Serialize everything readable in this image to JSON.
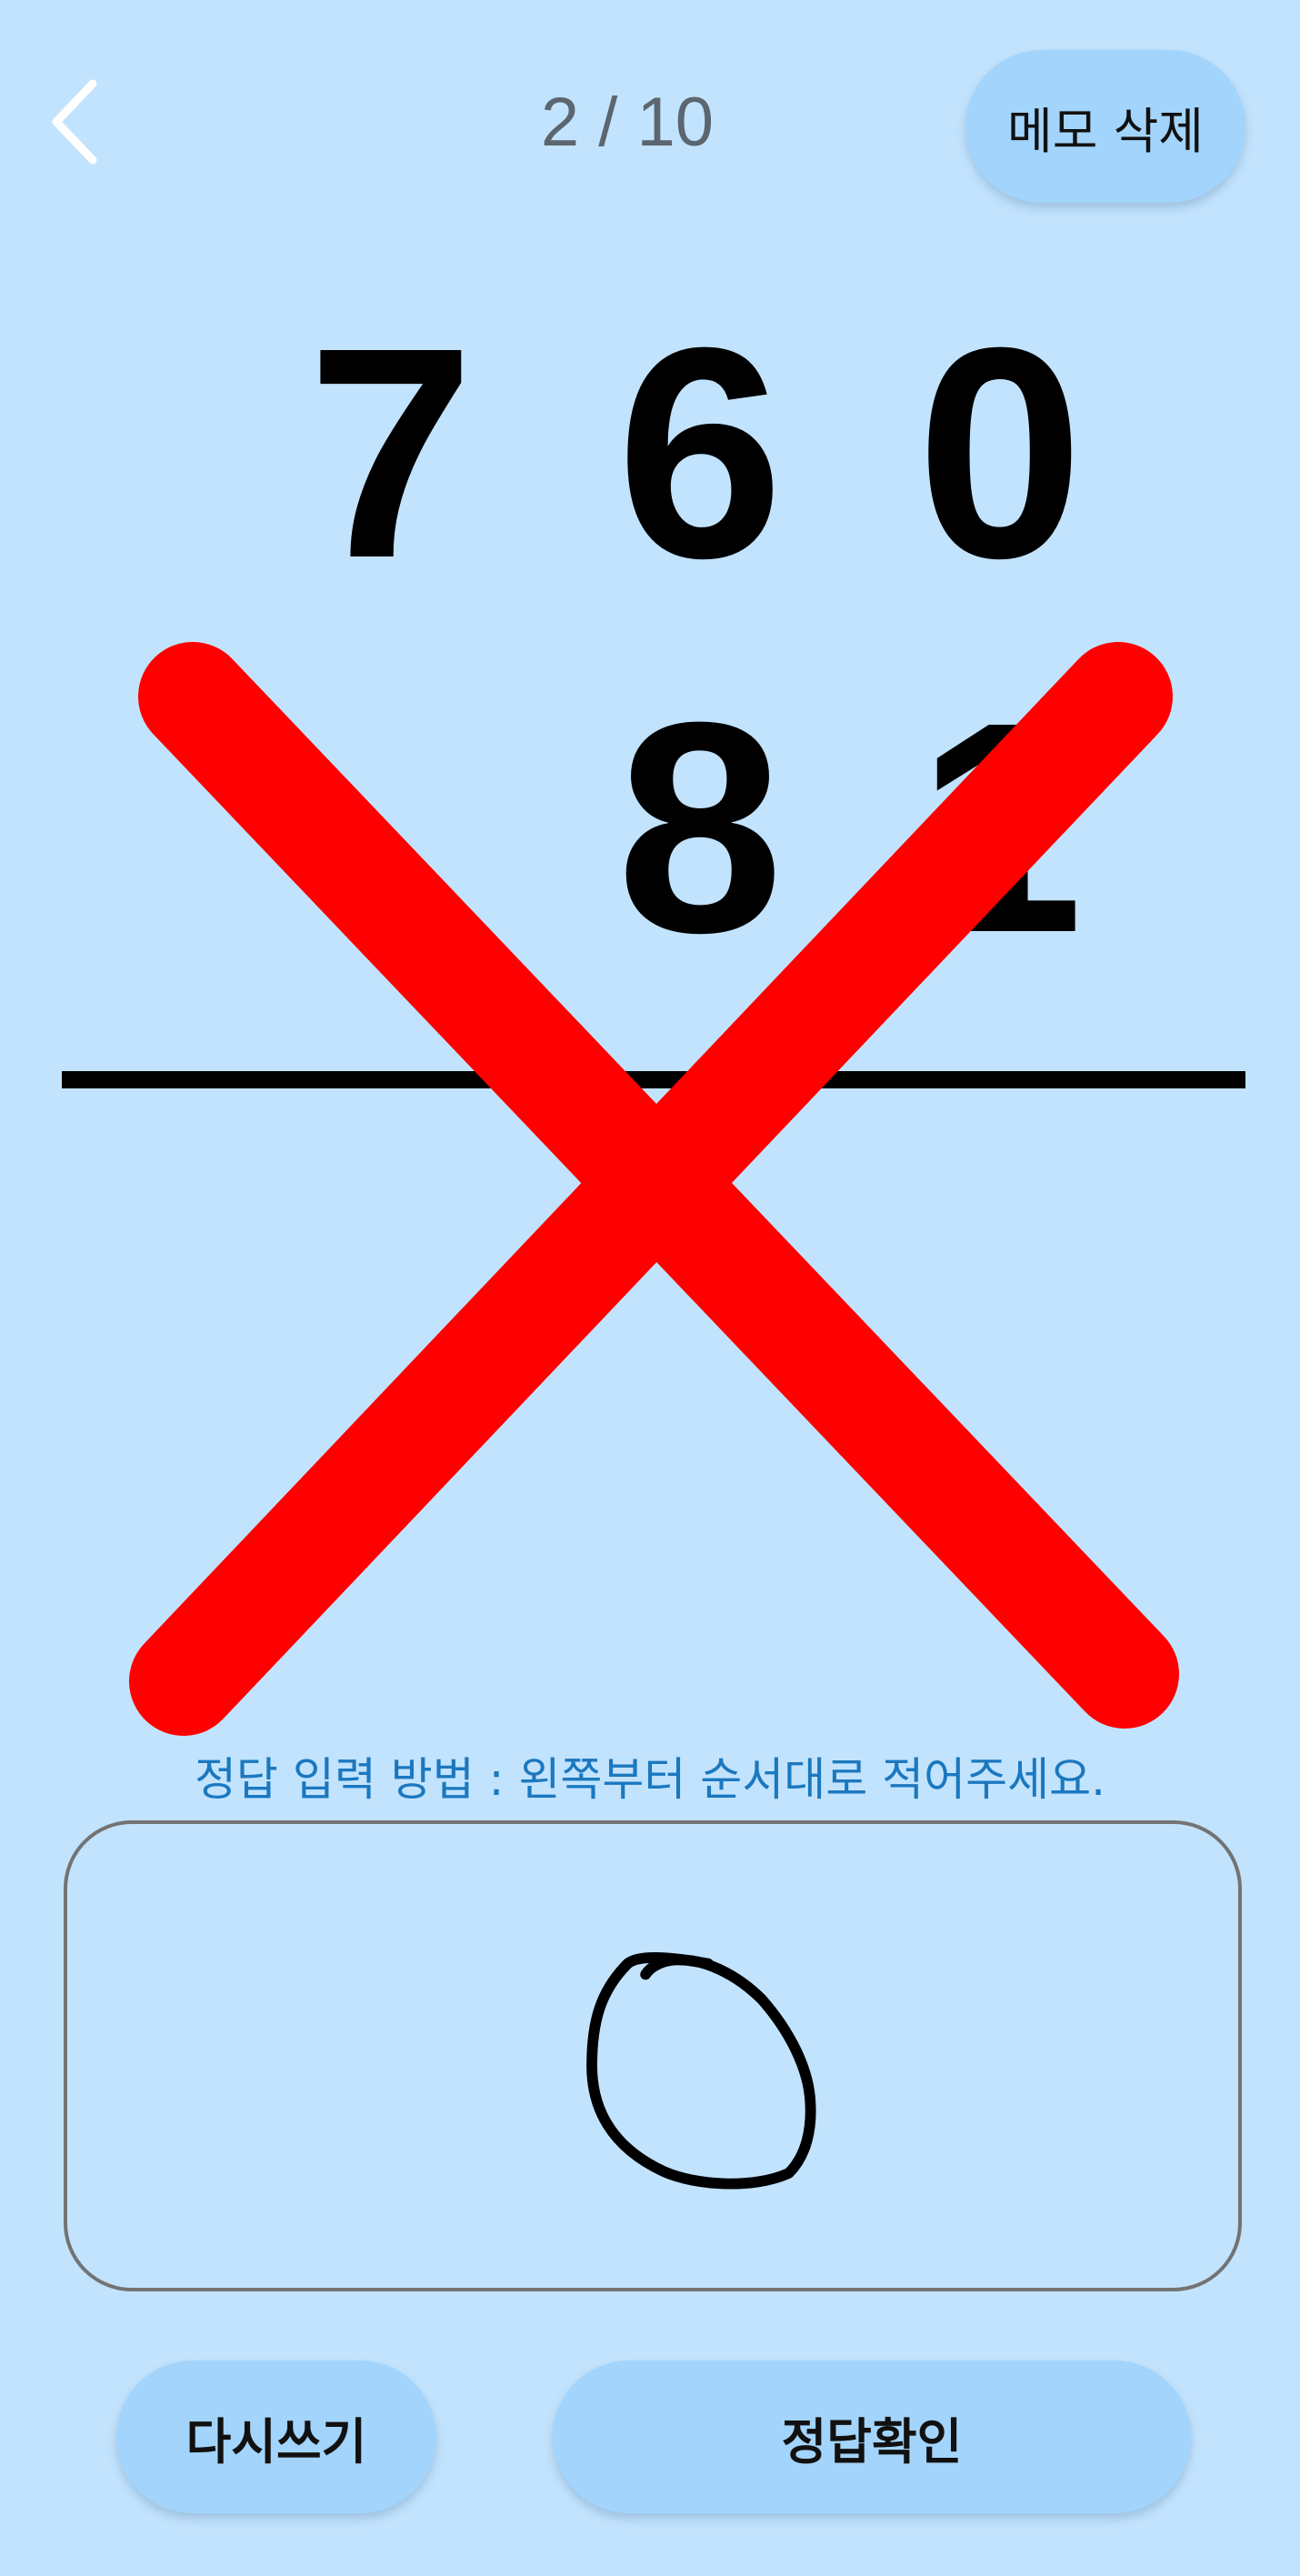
{
  "header": {
    "back_icon": "chevron-left-icon",
    "progress": "2 / 10",
    "memo_delete_label": "메모 삭제"
  },
  "problem": {
    "top_digits": [
      "7",
      "6",
      "0"
    ],
    "bottom_digits": [
      "8",
      "1"
    ]
  },
  "result_mark": {
    "icon": "red-cross-icon",
    "color": "#ff0000"
  },
  "answer": {
    "hint": "정답 입력 방법 : 왼쪽부터 순서대로 적어주세요.",
    "handwritten_value": "0"
  },
  "actions": {
    "rewrite_label": "다시쓰기",
    "check_answer_label": "정답확인"
  },
  "colors": {
    "background": "#c2e3fd",
    "button": "#a3d4fb",
    "hint_text": "#1b78bf",
    "mark": "#ff0000"
  }
}
